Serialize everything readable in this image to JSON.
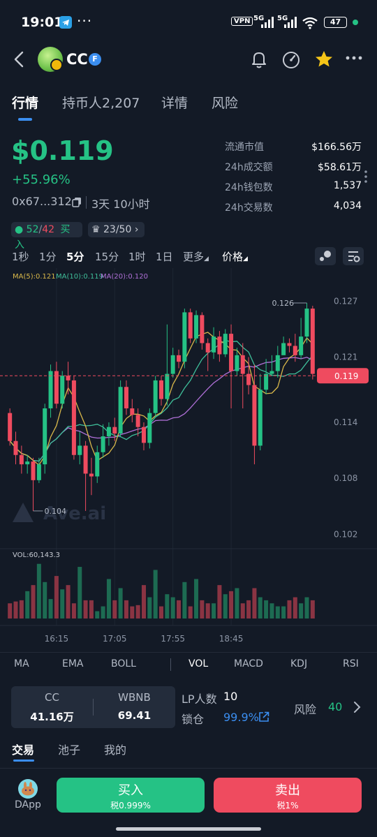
{
  "status_bar": {
    "time": "19:01",
    "dots": "···",
    "vpn": "VPN",
    "net1": "5G",
    "net2": "5G",
    "battery": "47"
  },
  "header": {
    "token_name": "CC",
    "verified_mark": "F"
  },
  "tabs": [
    {
      "label": "行情",
      "active": true
    },
    {
      "label": "持币人2,207",
      "active": false
    },
    {
      "label": "详情",
      "active": false
    },
    {
      "label": "风险",
      "active": false
    }
  ],
  "price": {
    "value": "$0.119",
    "change": "+55.96%",
    "address": "0x67...312a",
    "age": "3天 10小时"
  },
  "stats": [
    {
      "label": "流通市值",
      "value": "$166.56万"
    },
    {
      "label": "24h成交额",
      "value": "$58.61万"
    },
    {
      "label": "24h钱包数",
      "value": "1,537"
    },
    {
      "label": "24h交易数",
      "value": "4,034"
    }
  ],
  "pills": {
    "buy_sell_up": "52",
    "buy_sell_slash": "/",
    "buy_sell_down": "42",
    "buy_label": "买入",
    "holders_ratio": "23/50"
  },
  "timeframes": [
    {
      "label": "1秒",
      "active": false
    },
    {
      "label": "1分",
      "active": false
    },
    {
      "label": "5分",
      "active": true
    },
    {
      "label": "15分",
      "active": false
    },
    {
      "label": "1时",
      "active": false
    },
    {
      "label": "1日",
      "active": false
    },
    {
      "label": "更多",
      "active": false
    },
    {
      "label": "价格",
      "active": false
    }
  ],
  "chart_data": {
    "type": "candlestick",
    "ma_labels": {
      "ma5": "MA(5):0.121",
      "ma10": "MA(10):0.119",
      "ma20": "MA(20):0.120"
    },
    "y_ticks": [
      "0.127",
      "0.121",
      "0.114",
      "0.108",
      "0.102"
    ],
    "y_tick_values": [
      0.127,
      0.121,
      0.114,
      0.108,
      0.102
    ],
    "ylim": [
      0.1009,
      0.1286
    ],
    "x_ticks": [
      "16:15",
      "17:05",
      "17:55",
      "18:45"
    ],
    "x_tick_index": [
      8,
      18,
      28,
      38
    ],
    "current_price": "0.119",
    "current_price_value": 0.119,
    "high_label": "0.126",
    "low_label": "0.104",
    "watermark": "Ave.ai",
    "volume_label": "VOL:60,143.3",
    "candles": [
      [
        0.115,
        0.112,
        0.1155,
        0.1115
      ],
      [
        0.112,
        0.1105,
        0.113,
        0.1095
      ],
      [
        0.1105,
        0.1095,
        0.1115,
        0.1085
      ],
      [
        0.1095,
        0.1098,
        0.1105,
        0.1085
      ],
      [
        0.1098,
        0.1078,
        0.1102,
        0.1045
      ],
      [
        0.1078,
        0.1095,
        0.1102,
        0.1075
      ],
      [
        0.1095,
        0.1155,
        0.116,
        0.1085
      ],
      [
        0.1155,
        0.1195,
        0.1202,
        0.1145
      ],
      [
        0.1195,
        0.116,
        0.1205,
        0.1155
      ],
      [
        0.116,
        0.119,
        0.1195,
        0.1155
      ],
      [
        0.119,
        0.1185,
        0.1205,
        0.117
      ],
      [
        0.1185,
        0.1105,
        0.119,
        0.11
      ],
      [
        0.1105,
        0.1115,
        0.113,
        0.1095
      ],
      [
        0.1115,
        0.1085,
        0.112,
        0.1045
      ],
      [
        0.1085,
        0.1082,
        0.1102,
        0.1062
      ],
      [
        0.1082,
        0.1108,
        0.1115,
        0.1075
      ],
      [
        0.1108,
        0.1125,
        0.1138,
        0.1102
      ],
      [
        0.1125,
        0.1135,
        0.114,
        0.1115
      ],
      [
        0.1135,
        0.1128,
        0.1145,
        0.112
      ],
      [
        0.1128,
        0.1178,
        0.1185,
        0.1125
      ],
      [
        0.1178,
        0.1155,
        0.1185,
        0.1148
      ],
      [
        0.1155,
        0.1148,
        0.1165,
        0.114
      ],
      [
        0.1148,
        0.1135,
        0.1155,
        0.1125
      ],
      [
        0.1135,
        0.1118,
        0.114,
        0.111
      ],
      [
        0.1118,
        0.115,
        0.1155,
        0.1112
      ],
      [
        0.115,
        0.1185,
        0.119,
        0.1145
      ],
      [
        0.1185,
        0.1165,
        0.119,
        0.1158
      ],
      [
        0.1165,
        0.1192,
        0.1245,
        0.1158
      ],
      [
        0.1192,
        0.1212,
        0.122,
        0.1188
      ],
      [
        0.1212,
        0.1205,
        0.1218,
        0.1198
      ],
      [
        0.1205,
        0.1258,
        0.1262,
        0.1198
      ],
      [
        0.1258,
        0.123,
        0.1262,
        0.1225
      ],
      [
        0.123,
        0.1255,
        0.126,
        0.1225
      ],
      [
        0.1255,
        0.1225,
        0.1258,
        0.1218
      ],
      [
        0.1225,
        0.1215,
        0.123,
        0.1195
      ],
      [
        0.1215,
        0.1232,
        0.1242,
        0.1208
      ],
      [
        0.1232,
        0.1213,
        0.1238,
        0.1205
      ],
      [
        0.1213,
        0.1235,
        0.124,
        0.121
      ],
      [
        0.1235,
        0.1195,
        0.1245,
        0.1155
      ],
      [
        0.1195,
        0.1212,
        0.122,
        0.119
      ],
      [
        0.1212,
        0.1192,
        0.1225,
        0.1155
      ],
      [
        0.1192,
        0.118,
        0.121,
        0.117
      ],
      [
        0.118,
        0.1115,
        0.1202,
        0.1095
      ],
      [
        0.1115,
        0.1175,
        0.1192,
        0.111
      ],
      [
        0.1175,
        0.1192,
        0.1208,
        0.117
      ],
      [
        0.1192,
        0.1195,
        0.1212,
        0.119
      ],
      [
        0.1195,
        0.1212,
        0.1222,
        0.1188
      ],
      [
        0.1212,
        0.1225,
        0.1232,
        0.1215
      ],
      [
        0.1225,
        0.1222,
        0.123,
        0.1215
      ],
      [
        0.1222,
        0.1212,
        0.1235,
        0.1205
      ],
      [
        0.1212,
        0.1232,
        0.1252,
        0.1208
      ],
      [
        0.1232,
        0.1262,
        0.1268,
        0.1225
      ],
      [
        0.1262,
        0.1192,
        0.1265,
        0.1186
      ]
    ],
    "volumes": [
      0.25,
      0.28,
      0.3,
      0.45,
      0.55,
      0.9,
      0.6,
      0.32,
      0.7,
      0.48,
      0.55,
      0.25,
      0.85,
      0.3,
      0.3,
      0.12,
      0.2,
      0.65,
      0.3,
      0.5,
      0.3,
      0.2,
      0.22,
      0.55,
      0.35,
      0.8,
      0.2,
      0.4,
      0.35,
      0.3,
      0.6,
      0.2,
      0.65,
      0.3,
      0.25,
      0.25,
      0.55,
      0.4,
      0.45,
      0.5,
      0.25,
      0.3,
      0.5,
      0.35,
      0.3,
      0.25,
      0.2,
      0.2,
      0.3,
      0.35,
      0.25,
      0.35,
      0.3
    ]
  },
  "indicators": [
    {
      "label": "MA",
      "active": false
    },
    {
      "label": "EMA",
      "active": false
    },
    {
      "label": "BOLL",
      "active": false
    },
    {
      "label": "VOL",
      "active": true
    },
    {
      "label": "MACD",
      "active": false
    },
    {
      "label": "KDJ",
      "active": false
    },
    {
      "label": "RSI",
      "active": false
    }
  ],
  "lp": {
    "token_a": "CC",
    "token_a_amount": "41.16万",
    "token_b": "WBNB",
    "token_b_amount": "69.41",
    "lp_count_label": "LP人数",
    "lp_count": "10",
    "lock_label": "锁仓",
    "lock_value": "99.9%",
    "risk_label": "风险",
    "risk_value": "40"
  },
  "bottom_tabs": [
    {
      "label": "交易",
      "active": true
    },
    {
      "label": "池子",
      "active": false
    },
    {
      "label": "我的",
      "active": false
    }
  ],
  "actions": {
    "dapp_label": "DApp",
    "buy_label": "买入",
    "buy_tax": "税0.999%",
    "sell_label": "卖出",
    "sell_tax": "税1%"
  },
  "colors": {
    "background": "#131a26",
    "up": "#25c285",
    "down": "#ef4b5f",
    "accent": "#3b8ef0",
    "ma5": "#d9b84a",
    "ma10": "#3fbf9a",
    "ma20": "#b070d8"
  }
}
